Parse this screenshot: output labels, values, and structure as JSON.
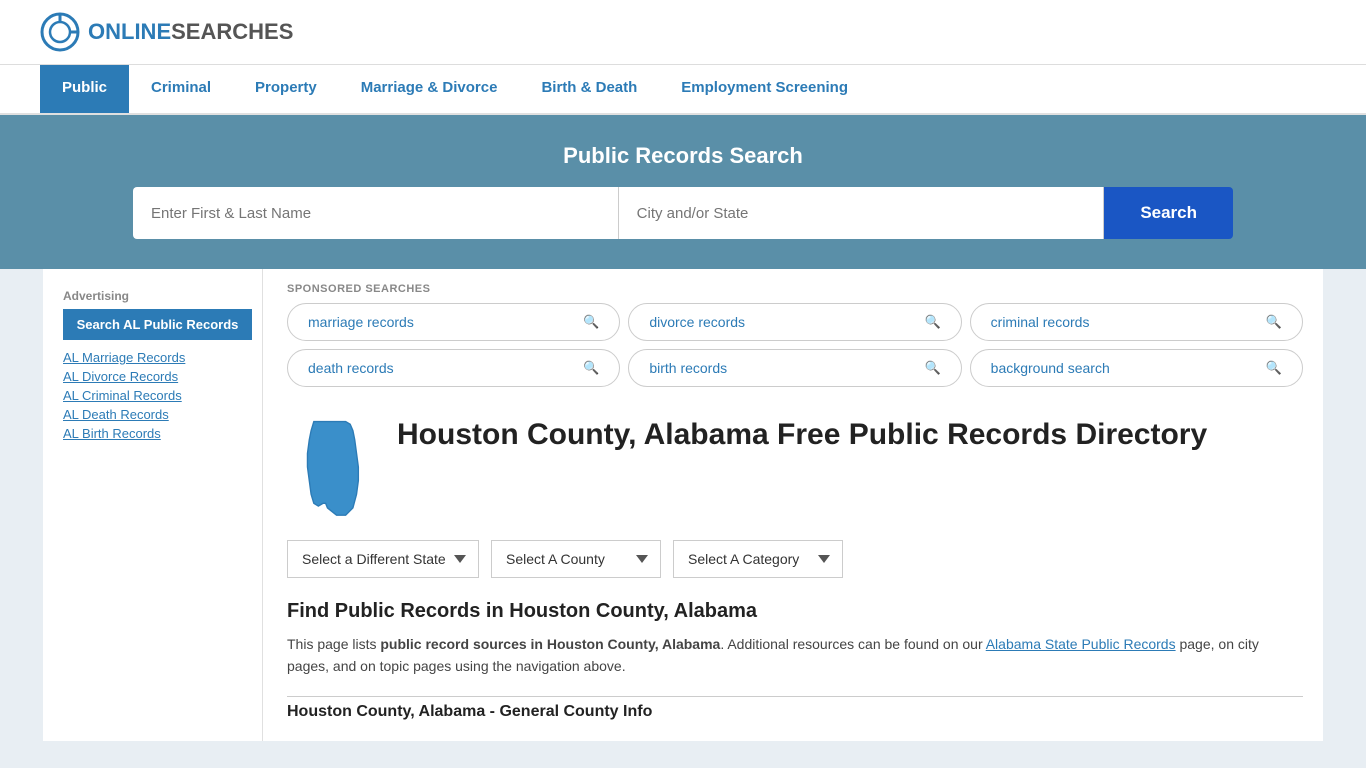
{
  "site": {
    "logo_online": "ONLINE",
    "logo_searches": "SEARCHES"
  },
  "nav": {
    "items": [
      {
        "label": "Public",
        "active": true
      },
      {
        "label": "Criminal",
        "active": false
      },
      {
        "label": "Property",
        "active": false
      },
      {
        "label": "Marriage & Divorce",
        "active": false
      },
      {
        "label": "Birth & Death",
        "active": false
      },
      {
        "label": "Employment Screening",
        "active": false
      }
    ]
  },
  "hero": {
    "title": "Public Records Search",
    "name_placeholder": "Enter First & Last Name",
    "location_placeholder": "City and/or State",
    "search_button": "Search"
  },
  "sponsored": {
    "label": "SPONSORED SEARCHES",
    "tags": [
      {
        "label": "marriage records"
      },
      {
        "label": "divorce records"
      },
      {
        "label": "criminal records"
      },
      {
        "label": "death records"
      },
      {
        "label": "birth records"
      },
      {
        "label": "background search"
      }
    ]
  },
  "page": {
    "title": "Houston County, Alabama Free Public Records Directory",
    "state_label": "Alabama",
    "dropdowns": {
      "state": "Select a Different State",
      "county": "Select A County",
      "category": "Select A Category"
    },
    "find_title": "Find Public Records in Houston County, Alabama",
    "find_text_1": "This page lists ",
    "find_text_bold": "public record sources in Houston County, Alabama",
    "find_text_2": ". Additional resources can be found on our ",
    "find_link": "Alabama State Public Records",
    "find_text_3": " page, on city pages, and on topic pages using the navigation above.",
    "section_title": "Houston County, Alabama - General County Info"
  },
  "sidebar": {
    "ad_label": "Advertising",
    "search_btn": "Search AL Public Records",
    "links": [
      "AL Marriage Records",
      "AL Divorce Records",
      "AL Criminal Records",
      "AL Death Records",
      "AL Birth Records"
    ]
  }
}
